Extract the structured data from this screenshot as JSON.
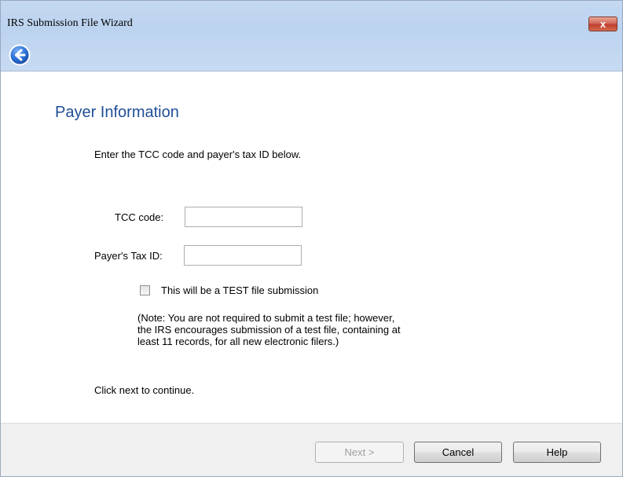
{
  "window": {
    "title": "IRS Submission File Wizard",
    "close_label": "x"
  },
  "page": {
    "title": "Payer Information",
    "intro": "Enter the TCC code and payer's tax ID below.",
    "continue_message": "Click next to continue."
  },
  "form": {
    "tcc_label": "TCC code:",
    "tcc_value": "",
    "tax_id_label": "Payer's Tax ID:",
    "tax_id_value": "",
    "test_checkbox_label": "This will be a TEST file submission",
    "test_checkbox_checked": false,
    "note_line1": "(Note: You are not required to submit a test file; however,",
    "note_line2": "the IRS encourages submission of a test file, containing at",
    "note_line3": "least 11 records, for all new electronic filers.)"
  },
  "footer": {
    "next_label": "Next >",
    "next_enabled": false,
    "cancel_label": "Cancel",
    "help_label": "Help"
  },
  "icons": {
    "back": "back-arrow-icon",
    "close": "close-icon"
  },
  "colors": {
    "title_bar": "#bcd3ef",
    "page_title": "#1f4e96",
    "close_button": "#c7503e",
    "back_button": "#2b6fd6"
  }
}
